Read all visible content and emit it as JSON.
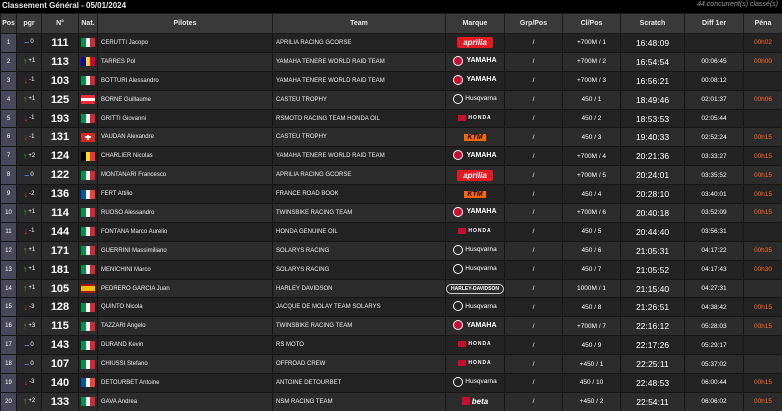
{
  "header": {
    "title": "Classement Général - 05/01/2024",
    "count": "44 concurrent(s) classé(s)"
  },
  "columns": [
    "Pos",
    "pgr",
    "N°",
    "Nat.",
    "Pilotes",
    "Team",
    "Marque",
    "Grp/Pos",
    "Cl/Pos",
    "Scratch",
    "Diff 1er",
    "Péna"
  ],
  "colors": {
    "up_arrow": "#3dbb3d",
    "down_arrow": "#e03030",
    "neutral": "#4a7fd8",
    "penalty": "#ff6a2a"
  },
  "rows": [
    {
      "pos": "1",
      "pgr": "0",
      "dir": "eq",
      "num": "111",
      "nat": "ITA",
      "pilot": "CERUTTI Jacopo",
      "team": "APRILIA RACING GCORSE",
      "brand": "aprilia",
      "brand_label": "aprilia",
      "grp": "/",
      "cl": "+700M / 1",
      "scratch": "16:48:09",
      "diff": "",
      "pena": "00h02"
    },
    {
      "pos": "2",
      "pgr": "+1",
      "dir": "up",
      "num": "113",
      "nat": "AND",
      "pilot": "TARRES Pol",
      "team": "YAMAHA TENERE WORLD RAID TEAM",
      "brand": "yamaha",
      "brand_label": "YAMAHA",
      "grp": "/",
      "cl": "+700M / 2",
      "scratch": "16:54:54",
      "diff": "00:06:45",
      "pena": "00h00"
    },
    {
      "pos": "3",
      "pgr": "-1",
      "dir": "down",
      "num": "103",
      "nat": "ITA",
      "pilot": "BOTTURI Alessandro",
      "team": "YAMAHA TENERE WORLD RAID TEAM",
      "brand": "yamaha",
      "brand_label": "YAMAHA",
      "grp": "/",
      "cl": "+700M / 3",
      "scratch": "16:56:21",
      "diff": "00:08:12",
      "pena": ""
    },
    {
      "pos": "4",
      "pgr": "+1",
      "dir": "up",
      "num": "125",
      "nat": "AUT",
      "pilot": "BORNE Guillaume",
      "team": "CASTEU TROPHY",
      "brand": "husqvarna",
      "brand_label": "Husqvarna",
      "grp": "/",
      "cl": "450 / 1",
      "scratch": "18:49:46",
      "diff": "02:01:37",
      "pena": "00h06"
    },
    {
      "pos": "5",
      "pgr": "-1",
      "dir": "down",
      "num": "193",
      "nat": "ITA",
      "pilot": "GRITTI Giovanni",
      "team": "RSMOTO RACING TEAM HONDA OIL",
      "brand": "honda",
      "brand_label": "HONDA",
      "grp": "/",
      "cl": "450 / 2",
      "scratch": "18:53:53",
      "diff": "02:05:44",
      "pena": ""
    },
    {
      "pos": "6",
      "pgr": "-1",
      "dir": "down",
      "num": "131",
      "nat": "SUI",
      "pilot": "VAUDAN Alexandre",
      "team": "CASTEU TROPHY",
      "brand": "ktm",
      "brand_label": "KTM",
      "grp": "/",
      "cl": "450 / 3",
      "scratch": "19:40:33",
      "diff": "02:52:24",
      "pena": "00h15"
    },
    {
      "pos": "7",
      "pgr": "+2",
      "dir": "up",
      "num": "124",
      "nat": "BEL",
      "pilot": "CHARLIER Nicolas",
      "team": "YAMAHA TENERE WORLD RAID TEAM",
      "brand": "yamaha",
      "brand_label": "YAMAHA",
      "grp": "/",
      "cl": "+700M / 4",
      "scratch": "20:21:36",
      "diff": "03:33:27",
      "pena": "00h15"
    },
    {
      "pos": "8",
      "pgr": "0",
      "dir": "eq",
      "num": "122",
      "nat": "ITA",
      "pilot": "MONTANARI Francesco",
      "team": "APRILIA RACING GCORSE",
      "brand": "aprilia",
      "brand_label": "aprilia",
      "grp": "/",
      "cl": "+700M / 5",
      "scratch": "20:24:01",
      "diff": "03:35:52",
      "pena": "00h15"
    },
    {
      "pos": "9",
      "pgr": "-2",
      "dir": "down",
      "num": "136",
      "nat": "FRA",
      "pilot": "FERT Attilio",
      "team": "FRANCE ROAD BOOK",
      "brand": "ktm",
      "brand_label": "KTM",
      "grp": "/",
      "cl": "450 / 4",
      "scratch": "20:28:10",
      "diff": "03:40:01",
      "pena": "00h15"
    },
    {
      "pos": "10",
      "pgr": "+1",
      "dir": "up",
      "num": "114",
      "nat": "ITA",
      "pilot": "RUOSO Alessandro",
      "team": "TWINSBIKE RACING TEAM",
      "brand": "yamaha",
      "brand_label": "YAMAHA",
      "grp": "/",
      "cl": "+700M / 6",
      "scratch": "20:40:18",
      "diff": "03:52:09",
      "pena": "00h15"
    },
    {
      "pos": "11",
      "pgr": "-1",
      "dir": "down",
      "num": "144",
      "nat": "ITA",
      "pilot": "FONTANA Marco Aurelio",
      "team": "HONDA GENUINE OIL",
      "brand": "honda",
      "brand_label": "HONDA",
      "grp": "/",
      "cl": "450 / 5",
      "scratch": "20:44:40",
      "diff": "03:56:31",
      "pena": ""
    },
    {
      "pos": "12",
      "pgr": "+1",
      "dir": "up",
      "num": "171",
      "nat": "ITA",
      "pilot": "GUERRINI Massimiliano",
      "team": "SOLARYS RACING",
      "brand": "husqvarna",
      "brand_label": "Husqvarna",
      "grp": "/",
      "cl": "450 / 6",
      "scratch": "21:05:31",
      "diff": "04:17:22",
      "pena": "00h35"
    },
    {
      "pos": "13",
      "pgr": "+1",
      "dir": "up",
      "num": "181",
      "nat": "ITA",
      "pilot": "MENICHINI Marco",
      "team": "SOLARYS RACING",
      "brand": "husqvarna",
      "brand_label": "Husqvarna",
      "grp": "/",
      "cl": "450 / 7",
      "scratch": "21:05:52",
      "diff": "04:17:43",
      "pena": "00h30"
    },
    {
      "pos": "14",
      "pgr": "+1",
      "dir": "up",
      "num": "105",
      "nat": "ESP",
      "pilot": "PEDRERO GARCIA Juan",
      "team": "HARLEY DAVIDSON",
      "brand": "harley",
      "brand_label": "HARLEY-DAVIDSON",
      "grp": "/",
      "cl": "1000M / 1",
      "scratch": "21:15:40",
      "diff": "04:27:31",
      "pena": ""
    },
    {
      "pos": "15",
      "pgr": "-3",
      "dir": "down",
      "num": "128",
      "nat": "ITA",
      "pilot": "QUINTO Nicola",
      "team": "JACQUE DE MOLAY TEAM SOLARYS",
      "brand": "husqvarna",
      "brand_label": "Husqvarna",
      "grp": "/",
      "cl": "450 / 8",
      "scratch": "21:26:51",
      "diff": "04:38:42",
      "pena": "00h15"
    },
    {
      "pos": "16",
      "pgr": "+3",
      "dir": "up",
      "num": "115",
      "nat": "ITA",
      "pilot": "TAZZARI Angelo",
      "team": "TWINSBIKE RACING TEAM",
      "brand": "yamaha",
      "brand_label": "YAMAHA",
      "grp": "/",
      "cl": "+700M / 7",
      "scratch": "22:16:12",
      "diff": "05:28:03",
      "pena": "00h15"
    },
    {
      "pos": "17",
      "pgr": "0",
      "dir": "eq",
      "num": "143",
      "nat": "ITA",
      "pilot": "DURAND Kevin",
      "team": "RS MOTO",
      "brand": "honda",
      "brand_label": "HONDA",
      "grp": "/",
      "cl": "450 / 9",
      "scratch": "22:17:26",
      "diff": "05:29:17",
      "pena": ""
    },
    {
      "pos": "18",
      "pgr": "0",
      "dir": "eq",
      "num": "107",
      "nat": "ITA",
      "pilot": "CHIUSSI Stefano",
      "team": "OFFROAD CREW",
      "brand": "honda",
      "brand_label": "HONDA",
      "grp": "/",
      "cl": "+450 / 1",
      "scratch": "22:25:11",
      "diff": "05:37:02",
      "pena": ""
    },
    {
      "pos": "19",
      "pgr": "-3",
      "dir": "down",
      "num": "140",
      "nat": "FRA",
      "pilot": "DETOURBET Antoine",
      "team": "ANTOINE DETOURBET",
      "brand": "husqvarna",
      "brand_label": "Husqvarna",
      "grp": "/",
      "cl": "450 / 10",
      "scratch": "22:48:53",
      "diff": "06:00:44",
      "pena": "00h15"
    },
    {
      "pos": "20",
      "pgr": "+2",
      "dir": "up",
      "num": "133",
      "nat": "ITA",
      "pilot": "GAVA Andrea",
      "team": "NSM RACING TEAM",
      "brand": "beta",
      "brand_label": "beta",
      "grp": "/",
      "cl": "+450 / 2",
      "scratch": "22:54:11",
      "diff": "06:06:02",
      "pena": "00h15"
    }
  ]
}
